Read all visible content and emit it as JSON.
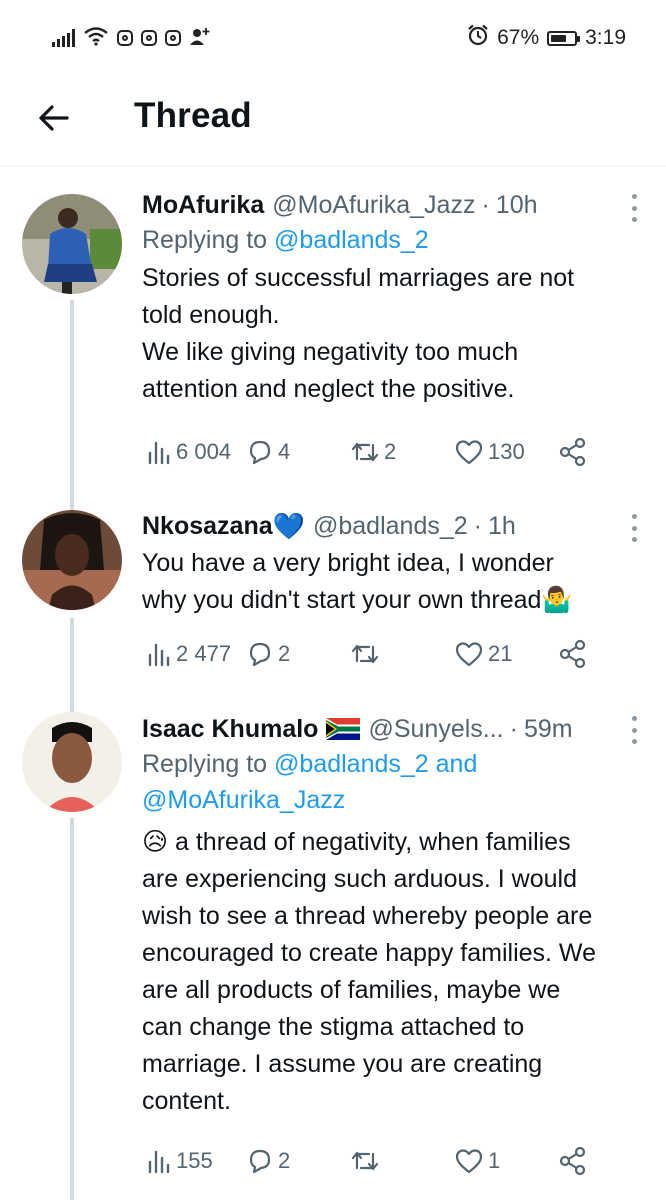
{
  "status_bar": {
    "battery": "67%",
    "time": "3:19",
    "battery_level": 0.67,
    "icons": [
      "signal-icon",
      "wifi-icon",
      "instagram-icon",
      "instagram-icon",
      "instagram-icon",
      "add-contact-icon",
      "alarm-icon",
      "battery-icon"
    ]
  },
  "header": {
    "title": "Thread",
    "back_icon": "arrow-left-icon"
  },
  "colors": {
    "accent": "#1d9bf0",
    "text": "#0f1419",
    "muted": "#536471",
    "thread_line": "#cfd9de"
  },
  "tweets": [
    {
      "name": "MoAfurika",
      "handle": "@MoAfurika_Jazz",
      "separator": "·",
      "time": "10h",
      "replying_prefix": "Replying to",
      "replying_to": "@badlands_2",
      "lines": [
        "Stories of successful marriages are not",
        "told enough.",
        "We like giving negativity too much",
        "attention and neglect the positive."
      ],
      "views": "6 004",
      "replies": "4",
      "retweets": "2",
      "likes": "130"
    },
    {
      "name": "Nkosazana",
      "name_emoji": "💙",
      "handle": "@badlands_2",
      "separator": "·",
      "time": "1h",
      "lines": [
        "You have a  very bright idea, I wonder",
        "why you didn't start your own thread🤷‍♂️"
      ],
      "views": "2 477",
      "replies": "2",
      "retweets": "",
      "likes": "21"
    },
    {
      "name": "Isaac Khumalo",
      "name_flag": "south-africa-flag-icon",
      "handle": "@Sunyels...",
      "separator": "·",
      "time": "59m",
      "replying_prefix": "Replying to",
      "replying_to": "@badlands_2",
      "replying_and": "and",
      "replying_to_2": "@MoAfurika_Jazz",
      "lines": [
        "😥 a thread of negativity, when families",
        "are experiencing such arduous. I would",
        "wish to see a thread whereby people are",
        "encouraged to create happy families. We",
        "are all products of families, maybe we",
        "can change the stigma attached to",
        "marriage. I assume you are creating",
        "content."
      ],
      "views": "155",
      "replies": "2",
      "retweets": "",
      "likes": "1"
    }
  ]
}
